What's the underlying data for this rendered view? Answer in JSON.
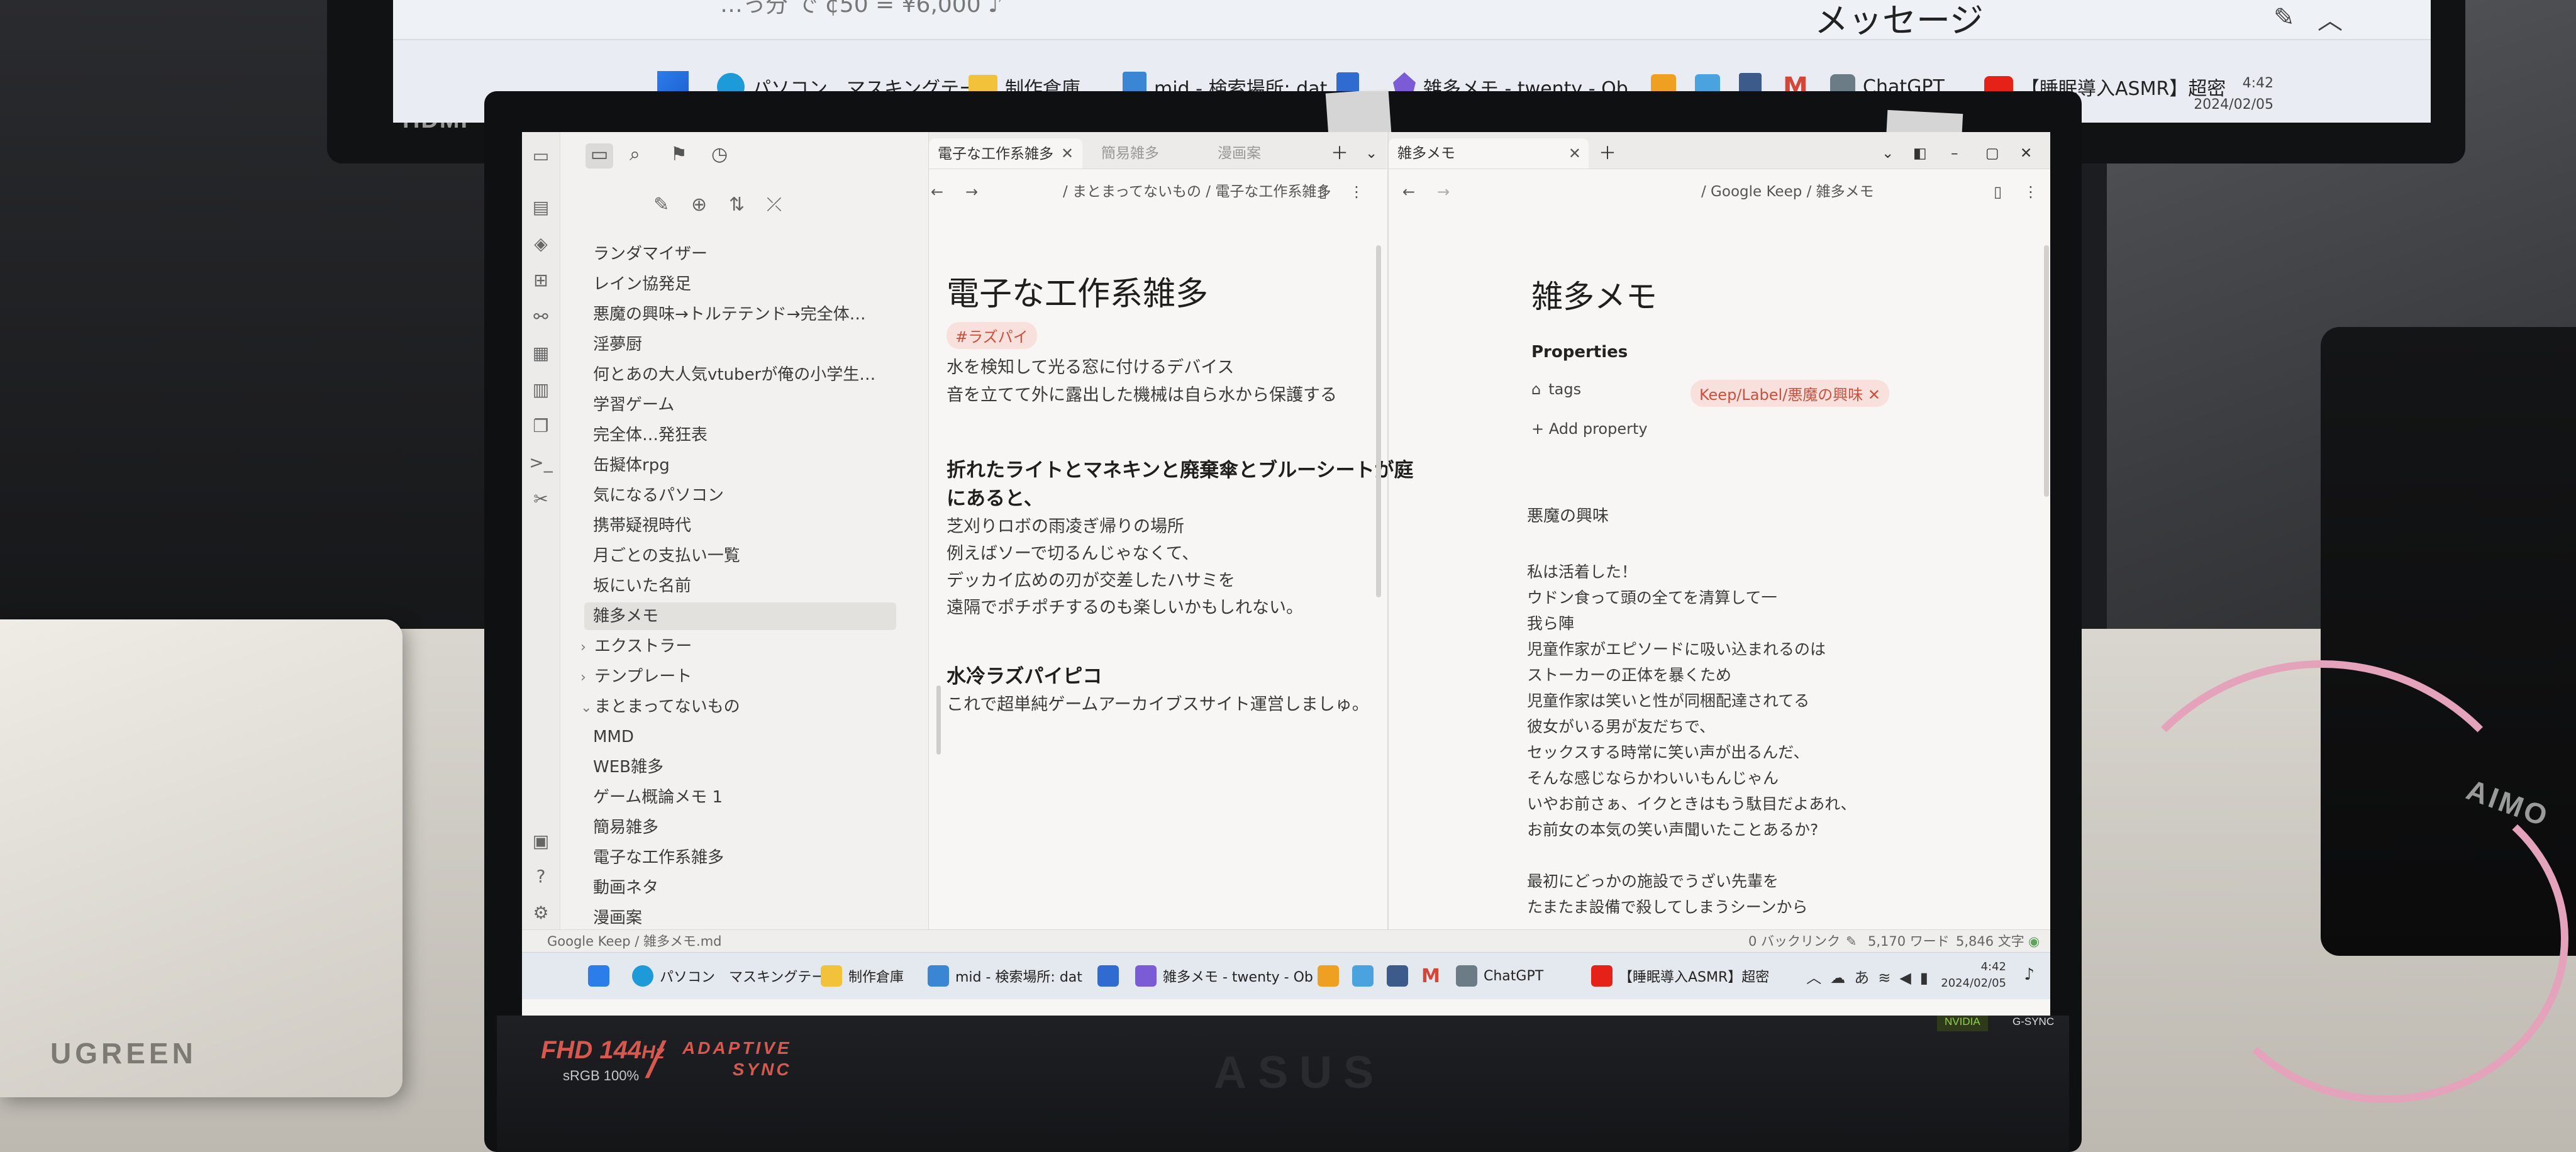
{
  "external_monitor": {
    "header_text": "メッセージ",
    "taskbar_items": [
      {
        "label": "パソコン　マスキングテープ",
        "icon": "edge-icon"
      },
      {
        "label": "制作倉庫",
        "icon": "folder-icon"
      },
      {
        "label": "mid - 検索場所: dat",
        "icon": "file-icon"
      },
      {
        "label": "",
        "icon": "notepad-icon"
      },
      {
        "label": "雑多メモ - twenty - Ob",
        "icon": "obsidian-icon"
      },
      {
        "label": "ChatGPT",
        "icon": "chatgpt-icon"
      },
      {
        "label": "【睡眠導入ASMR】超密",
        "icon": "youtube-icon"
      }
    ],
    "clock_time": "4:42",
    "clock_date": "2024/02/05",
    "cropped_top_text": "…っ分 で ¢50 = ¥6,000 ♪"
  },
  "monitor_brand": "HDMI",
  "laptop": {
    "fhd": "FHD",
    "hz": "144",
    "hz_unit": "Hz",
    "srgb": "sRGB 100%",
    "adaptive_line1": "ADAPTIVE",
    "adaptive_line2": "SYNC",
    "brand": "ASUS",
    "nvidia": "NVIDIA",
    "gsync": "G-SYNC"
  },
  "stand_brand": "UGREEN",
  "speaker_brand": "AIMO",
  "sidebar": {
    "tree": [
      {
        "label": "ランダマイザー",
        "indent": 1
      },
      {
        "label": "レイン協発足",
        "indent": 1
      },
      {
        "label": "悪魔の興味→トルテテンド→完全体…",
        "indent": 1
      },
      {
        "label": "淫夢厨",
        "indent": 1
      },
      {
        "label": "何とあの大人気vtuberが俺の小学生…",
        "indent": 1
      },
      {
        "label": "学習ゲーム",
        "indent": 1
      },
      {
        "label": "完全体…発狂表",
        "indent": 1
      },
      {
        "label": "缶擬体rpg",
        "indent": 1
      },
      {
        "label": "気になるパソコン",
        "indent": 1
      },
      {
        "label": "携帯疑視時代",
        "indent": 1
      },
      {
        "label": "月ごとの支払い一覧",
        "indent": 1
      },
      {
        "label": "坂にいた名前",
        "indent": 1
      },
      {
        "label": "雑多メモ",
        "indent": 1,
        "active": true
      },
      {
        "label": "エクストラー",
        "indent": 0,
        "folder": "collapsed"
      },
      {
        "label": "テンプレート",
        "indent": 0,
        "folder": "collapsed"
      },
      {
        "label": "まとまってないもの",
        "indent": 0,
        "folder": "expanded"
      },
      {
        "label": "MMD",
        "indent": 1
      },
      {
        "label": "WEB雑多",
        "indent": 1
      },
      {
        "label": "ゲーム概論メモ 1",
        "indent": 1
      },
      {
        "label": "簡易雑多",
        "indent": 1
      },
      {
        "label": "電子な工作系雑多",
        "indent": 1
      },
      {
        "label": "動画ネタ",
        "indent": 1
      },
      {
        "label": "漫画案",
        "indent": 1
      }
    ]
  },
  "left_pane": {
    "tabs": [
      {
        "label": "電子な工作系雑多",
        "active": true
      },
      {
        "label": "簡易雑多",
        "active": false
      },
      {
        "label": "漫画案",
        "active": false
      }
    ],
    "breadcrumb": "/ まとまってないもの / 電子な工作系雑多",
    "title": "電子な工作系雑多",
    "tag": "#ラズパイ",
    "lines1": [
      "水を検知して光る窓に付けるデバイス",
      "音を立てて外に露出した機械は自ら水から保護する"
    ],
    "heading2_line1": "折れたライトとマネキンと廃棄傘とブルーシートが庭",
    "heading2_line2": "にあると、",
    "lines2": [
      "芝刈りロボの雨凌ぎ帰りの場所",
      "例えばソーで切るんじゃなくて、",
      "デッカイ広めの刃が交差したハサミを",
      "遠隔でポチポチするのも楽しいかもしれない。"
    ],
    "heading3": "水冷ラズパイピコ",
    "lines3": [
      "これで超単純ゲームアーカイブスサイト運営しましゅ。"
    ]
  },
  "right_pane": {
    "tab": "雑多メモ",
    "breadcrumb": "/ Google Keep / 雑多メモ",
    "title": "雑多メモ",
    "properties_label": "Properties",
    "tags_label": "tags",
    "tag_value": "Keep/Label/悪魔の興味",
    "add_property": "+ Add property",
    "section_title": "悪魔の興味",
    "lines": [
      "私は活着した！",
      "ウドン食って頭の全てを清算して一",
      "我ら陣",
      "児童作家がエピソードに吸い込まれるのは",
      "ストーカーの正体を暴くため",
      "児童作家は笑いと性が同梱配達されてる",
      "彼女がいる男が友だちで、",
      "セックスする時常に笑い声が出るんだ、",
      "そんな感じならかわいいもんじゃん",
      "いやお前さぁ、イクときはもう駄目だよあれ、",
      "お前女の本気の笑い声聞いたことあるか?",
      "",
      "最初にどっかの施設でうざい先輩を",
      "たまたま設備で殺してしまうシーンから"
    ]
  },
  "statusbar": {
    "path": "Google Keep / 雑多メモ.md",
    "backlinks": "0 バックリンク",
    "words": "5,170 ワード",
    "chars": "5,846 文字"
  },
  "laptop_taskbar": {
    "items": [
      {
        "label": "パソコン　マスキングテープ"
      },
      {
        "label": "制作倉庫"
      },
      {
        "label": "mid - 検索場所: dat"
      },
      {
        "label": "雑多メモ - twenty - Ob"
      },
      {
        "label": "ChatGPT"
      },
      {
        "label": "【睡眠導入ASMR】超密"
      }
    ],
    "ime": "あ",
    "clock_time": "4:42",
    "clock_date": "2024/02/05"
  }
}
